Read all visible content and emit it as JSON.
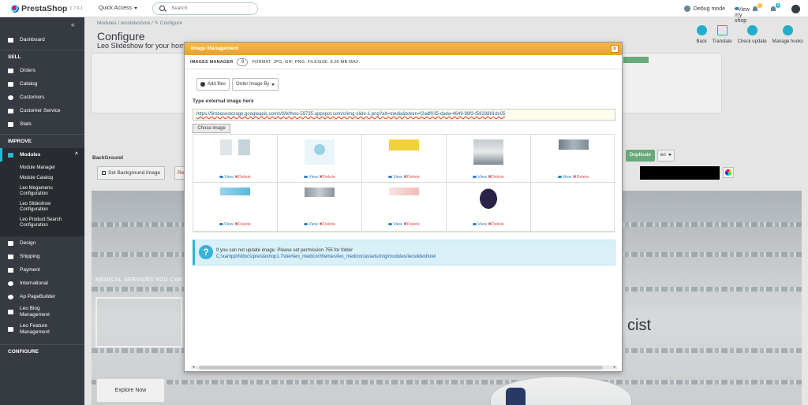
{
  "header": {
    "logo_text": "PrestaShop",
    "version": "1.7.6.1",
    "quick_access": "Quick Access",
    "search_placeholder": "Search",
    "debug_mode": "Debug mode",
    "view_shop": "View my shop",
    "notif_count_1": "1",
    "notif_count_2": "4"
  },
  "sidebar": {
    "dashboard": "Dashboard",
    "section_sell": "SELL",
    "orders": "Orders",
    "catalog": "Catalog",
    "customers": "Customers",
    "customer_service": "Customer Service",
    "stats": "Stats",
    "section_improve": "IMPROVE",
    "modules": "Modules",
    "sub_items": [
      "Module Manager",
      "Module Catalog",
      "Leo Megamenu Configuration",
      "Leo Slideshow Configuration",
      "Leo Product Search Configuration"
    ],
    "design": "Design",
    "shipping": "Shipping",
    "payment": "Payment",
    "international": "International",
    "ap_pagebuilder": "Ap PageBuilder",
    "leo_blog": "Leo Blog Management",
    "leo_feature": "Leo Feature Management",
    "section_configure": "CONFIGURE"
  },
  "main": {
    "breadcrumb": "Modules  /  leoslideshow  /  ✎ Configure",
    "page_title": "Configure",
    "page_subtitle": "Leo Slideshow for your home",
    "toolbar": [
      "Back",
      "Translate",
      "Check update",
      "Manage hooks"
    ],
    "background_label": "BackGround",
    "set_bg_button": "Set Background Image",
    "reset_button_fragment": "Re",
    "duplicate_button": "Duplicate",
    "lang_select": "en",
    "hero_tagline": "MEDICAL SERVICES YOU CAN",
    "hero_word": "cist",
    "explore_button": "Explore Now"
  },
  "modal": {
    "title": "Image Management",
    "close": "×",
    "images_manager_label": "IMAGES MANAGER",
    "images_count": "9",
    "formats": "FORMAT: JPG, GIF, PNG. FILESIZE: 8.00 MB MAX.",
    "add_files": "Add files",
    "order_by": "Order Image By",
    "external_label": "Type external image here",
    "external_value": "https://firebasestorage.googleapis.com/v0/b/theo-59735.appspot.com/o/img-slide-1.png?alt=media&token=f2adf035-dada-4649-98f3-f5633881dc05",
    "choose_image": "Chose image",
    "view_label": "View",
    "delete_label": "Delete",
    "images": [
      {
        "name": "thumb-doctor-1"
      },
      {
        "name": "thumb-flowers"
      },
      {
        "name": "thumb-yellow-banner"
      },
      {
        "name": "thumb-pharmacist"
      },
      {
        "name": "thumb-shelves"
      },
      {
        "name": "thumb-blue-strip"
      },
      {
        "name": "thumb-lab"
      },
      {
        "name": "thumb-pink"
      },
      {
        "name": "thumb-silhouette"
      }
    ],
    "info_line1": "If you can not update image. Please set permission 755 for folder",
    "info_line2": "C:\\xampp\\htdocs\\prestashop1.7\\dev\\leo_medicor/themes/leo_medicor/assets/img/modules/leoslideshow/"
  },
  "colors": {
    "accent": "#25b9d7",
    "modal_header": "#eaa22b",
    "sidebar": "#363a41",
    "duplicate": "#70b580"
  }
}
